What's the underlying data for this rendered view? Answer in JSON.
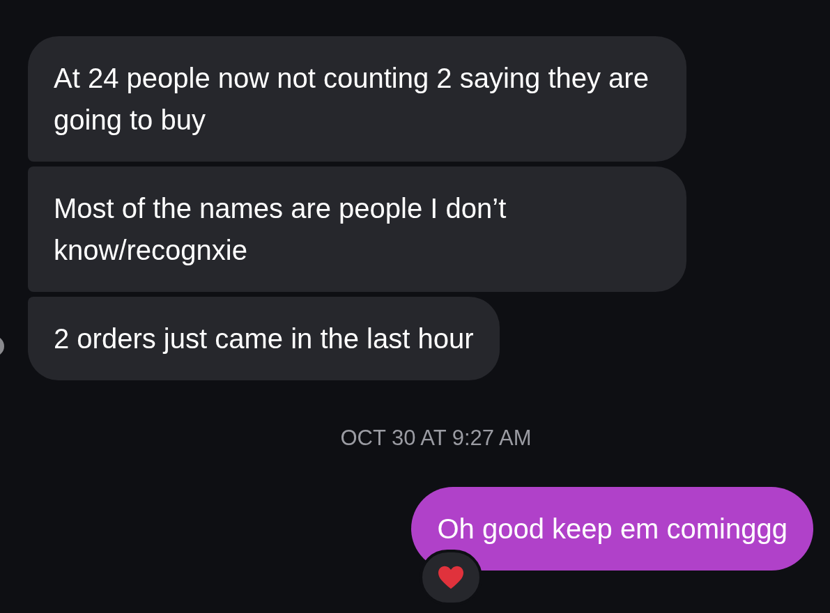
{
  "messages": [
    {
      "kind": "received",
      "text": "At 24 people now not counting 2 saying they are going to buy"
    },
    {
      "kind": "received",
      "text": "Most of the names are people I don’t know/recognxie"
    },
    {
      "kind": "received",
      "text": "2 orders just came in the last hour"
    },
    {
      "kind": "timestamp",
      "text": "OCT 30 AT 9:27 AM"
    },
    {
      "kind": "sent",
      "text": "Oh good keep em cominggg",
      "reaction": {
        "kind": "heart"
      }
    }
  ]
}
